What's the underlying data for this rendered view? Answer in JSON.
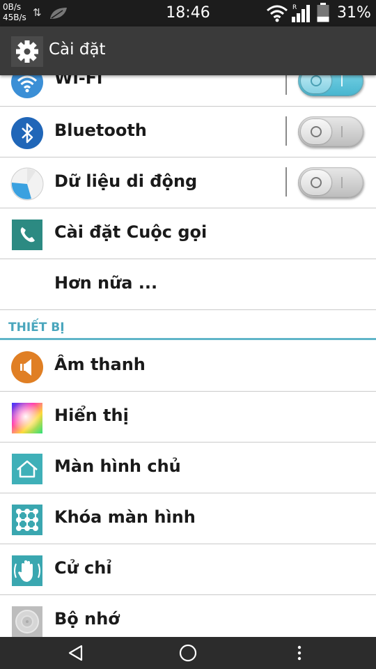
{
  "status_bar": {
    "speed_up": "0B/s",
    "speed_down": "45B/s",
    "time": "18:46",
    "roaming_indicator": "R",
    "battery_percent": "31%",
    "battery_level": 0.31
  },
  "action_bar": {
    "title": "Cài đặt",
    "icon": "gear-icon"
  },
  "rows_top": [
    {
      "label": "Wi-Fi",
      "icon": "wifi-icon",
      "toggle": "on"
    },
    {
      "label": "Bluetooth",
      "icon": "bluetooth-icon",
      "toggle": "off"
    },
    {
      "label": "Dữ liệu di động",
      "icon": "mobile-data-icon",
      "toggle": "off"
    },
    {
      "label": "Cài đặt Cuộc gọi",
      "icon": "phone-icon"
    },
    {
      "label": "Hơn nữa ..."
    }
  ],
  "section": {
    "title": "THIẾT BỊ"
  },
  "rows_device": [
    {
      "label": "Âm thanh",
      "icon": "speaker-icon"
    },
    {
      "label": "Hiển thị",
      "icon": "display-icon"
    },
    {
      "label": "Màn hình chủ",
      "icon": "home-screen-icon"
    },
    {
      "label": "Khóa màn hình",
      "icon": "lock-pattern-icon"
    },
    {
      "label": "Cử chỉ",
      "icon": "gesture-icon"
    },
    {
      "label": "Bộ nhớ",
      "icon": "storage-icon"
    }
  ],
  "nav_bar": {
    "back": "back-icon",
    "home": "home-icon",
    "menu": "menu-icon"
  },
  "colors": {
    "accent": "#4aa6bd",
    "action_bar": "#3a3a3a",
    "status_bar": "#1c1c1c",
    "toggle_on": "#5cc3db"
  }
}
